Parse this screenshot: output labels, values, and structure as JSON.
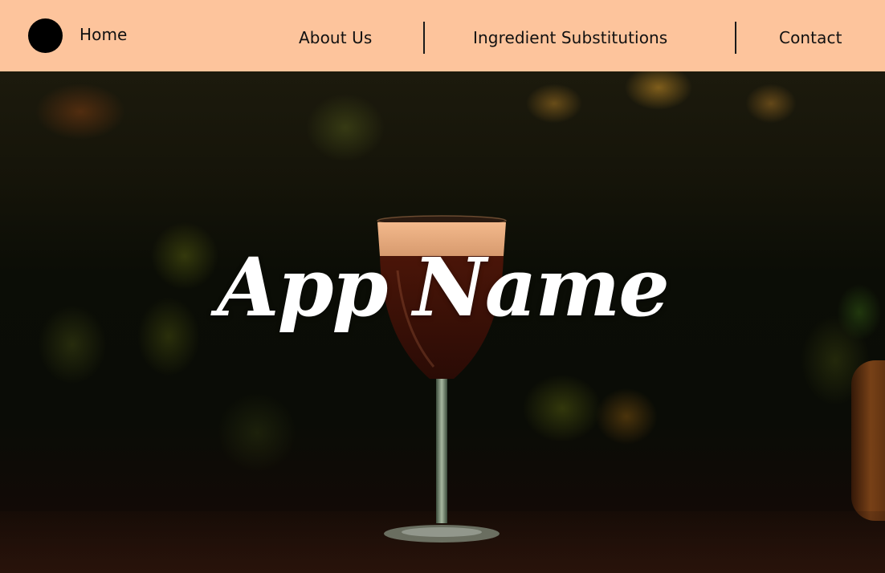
{
  "nav": {
    "home_label": "Home",
    "links": [
      {
        "label": "About Us"
      },
      {
        "label": "Ingredient Substitutions"
      },
      {
        "label": "Contact"
      }
    ]
  },
  "hero": {
    "title": "App Name",
    "background_description_icon": "cocktail-glass-image"
  },
  "colors": {
    "nav_background": "#fdc49c",
    "logo": "#000000",
    "title_text": "#ffffff"
  }
}
